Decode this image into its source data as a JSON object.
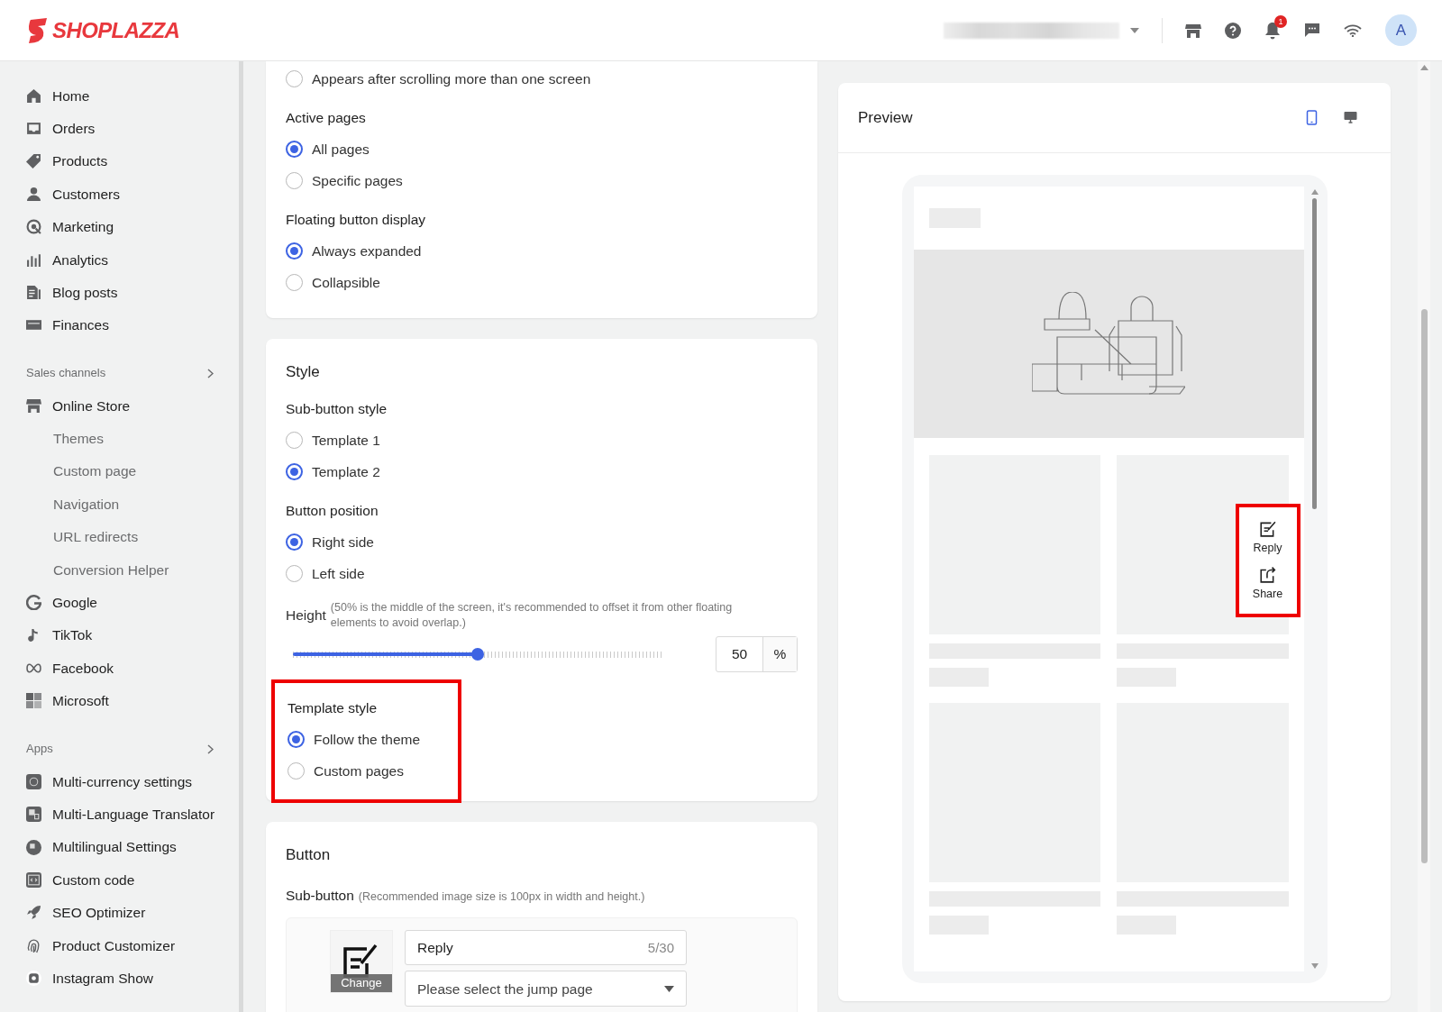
{
  "header": {
    "logo": "SHOPLAZZA",
    "notification_count": "1",
    "avatar": "A"
  },
  "sidebar": {
    "main": [
      {
        "label": "Home"
      },
      {
        "label": "Orders"
      },
      {
        "label": "Products"
      },
      {
        "label": "Customers"
      },
      {
        "label": "Marketing"
      },
      {
        "label": "Analytics"
      },
      {
        "label": "Blog posts"
      },
      {
        "label": "Finances"
      }
    ],
    "sections": [
      {
        "title": "Sales channels",
        "items": [
          {
            "label": "Online Store",
            "children": [
              {
                "label": "Themes"
              },
              {
                "label": "Custom page"
              },
              {
                "label": "Navigation"
              },
              {
                "label": "URL redirects"
              },
              {
                "label": "Conversion Helper"
              }
            ]
          },
          {
            "label": "Google"
          },
          {
            "label": "TikTok"
          },
          {
            "label": "Facebook"
          },
          {
            "label": "Microsoft"
          }
        ]
      },
      {
        "title": "Apps",
        "items": [
          {
            "label": "Multi-currency settings"
          },
          {
            "label": "Multi-Language Translator"
          },
          {
            "label": "Multilingual Settings"
          },
          {
            "label": "Custom code"
          },
          {
            "label": "SEO Optimizer"
          },
          {
            "label": "Product Customizer"
          },
          {
            "label": "Instagram Show"
          }
        ]
      }
    ]
  },
  "settings_card": {
    "options": [
      {
        "label": "Appears after scrolling more than one screen",
        "selected": false
      }
    ],
    "groups": [
      {
        "title": "Active pages",
        "options": [
          {
            "label": "All pages",
            "selected": true
          },
          {
            "label": "Specific pages",
            "selected": false
          }
        ]
      },
      {
        "title": "Floating button display",
        "options": [
          {
            "label": "Always expanded",
            "selected": true
          },
          {
            "label": "Collapsible",
            "selected": false
          }
        ]
      }
    ]
  },
  "style_card": {
    "title": "Style",
    "groups": [
      {
        "title": "Sub-button style",
        "options": [
          {
            "label": "Template 1",
            "selected": false
          },
          {
            "label": "Template 2",
            "selected": true
          }
        ]
      },
      {
        "title": "Button position",
        "options": [
          {
            "label": "Right side",
            "selected": true
          },
          {
            "label": "Left side",
            "selected": false
          }
        ]
      }
    ],
    "height": {
      "label": "Height",
      "hint": "(50% is the middle of the screen, it's recommended to offset it from other floating elements to avoid overlap.)",
      "level": 0.5,
      "value": "50",
      "unit": "%"
    },
    "template_style": {
      "title": "Template style",
      "highlighted": true,
      "options": [
        {
          "label": "Follow the theme",
          "selected": true
        },
        {
          "label": "Custom pages",
          "selected": false
        }
      ]
    }
  },
  "button_card": {
    "title": "Button",
    "sub_button_label": "Sub-button",
    "sub_button_hint": "(Recommended image size is 100px in width and height.)",
    "change_label": "Change",
    "name_value": "Reply",
    "name_counter": "5/30",
    "jump_placeholder": "Please select the jump page"
  },
  "preview": {
    "title": "Preview",
    "devices": [
      {
        "selected": true
      },
      {
        "selected": false
      }
    ],
    "floating_highlighted": true,
    "floating_buttons": [
      {
        "label": "Reply"
      },
      {
        "label": "Share"
      }
    ]
  }
}
